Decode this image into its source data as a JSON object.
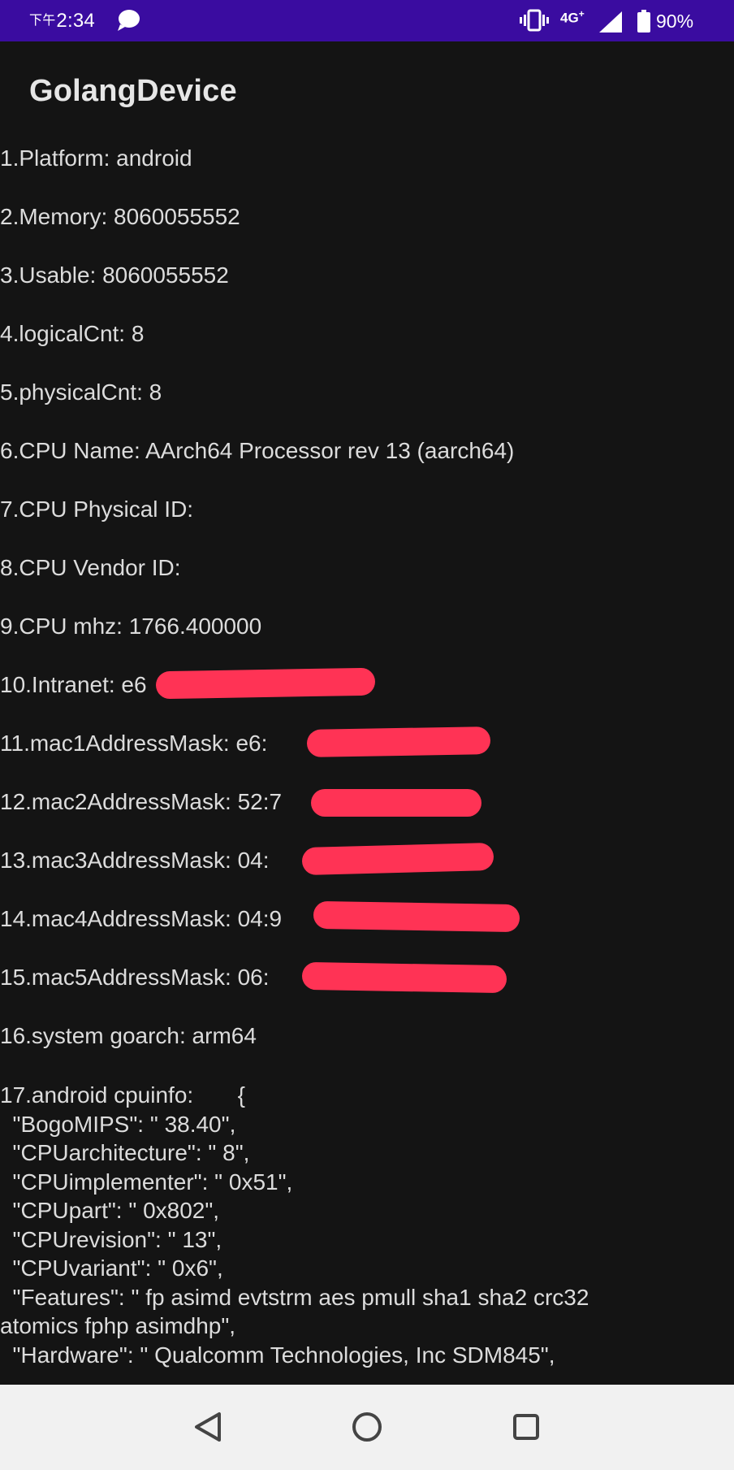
{
  "status_bar": {
    "time_prefix": "下午",
    "time": "2:34",
    "network_type": "4G",
    "network_plus": "+",
    "battery": "90%",
    "background_color": "#3a0ca0",
    "icons": [
      "chat-bubble-icon",
      "vibrate-icon",
      "signal-icon",
      "battery-icon"
    ]
  },
  "app": {
    "title": "GolangDevice"
  },
  "info_lines": [
    "1.Platform: android",
    "2.Memory: 8060055552",
    "3.Usable: 8060055552",
    "4.logicalCnt: 8",
    "5.physicalCnt: 8",
    "6.CPU Name: AArch64 Processor rev 13 (aarch64)",
    "7.CPU Physical ID:",
    "8.CPU Vendor ID:",
    "9.CPU mhz: 1766.400000",
    "10.Intranet: e6",
    "11.mac1AddressMask: e6:",
    "12.mac2AddressMask: 52:7",
    "13.mac3AddressMask: 04:",
    "14.mac4AddressMask: 04:9",
    "15.mac5AddressMask: 06:",
    "16.system goarch: arm64"
  ],
  "redaction_color": "#ff3355",
  "cpuinfo": {
    "header": "17.android cpuinfo:       {",
    "entries": [
      "  \"BogoMIPS\": \" 38.40\",",
      "  \"CPUarchitecture\": \" 8\",",
      "  \"CPUimplementer\": \" 0x51\",",
      "  \"CPUpart\": \" 0x802\",",
      "  \"CPUrevision\": \" 13\",",
      "  \"CPUvariant\": \" 0x6\",",
      "  \"Features\": \" fp asimd evtstrm aes pmull sha1 sha2 crc32",
      "atomics fphp asimdhp\",",
      "  \"Hardware\": \" Qualcomm Technologies, Inc SDM845\","
    ]
  },
  "nav_bar": {
    "buttons": [
      "back-icon",
      "home-icon",
      "recents-icon"
    ]
  }
}
